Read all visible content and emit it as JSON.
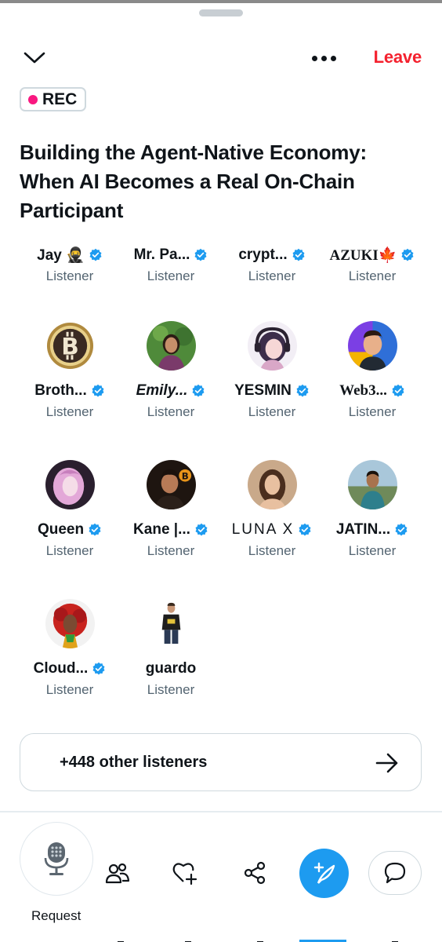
{
  "header": {
    "leave_label": "Leave",
    "collapse_icon": "chevron-down-icon",
    "more_icon": "more-dots-icon"
  },
  "rec_badge": {
    "label": "REC",
    "dot_color": "#f91880"
  },
  "space_title": "Building the Agent-Native Economy: When AI Becomes a Real On-Chain Participant",
  "participants": [
    {
      "name": "Jay 🥷",
      "role": "Listener",
      "verified": true
    },
    {
      "name": "Mr. Pa...",
      "role": "Listener",
      "verified": true
    },
    {
      "name": "crypt...",
      "role": "Listener",
      "verified": true
    },
    {
      "name": "AZUKI🍁",
      "role": "Listener",
      "verified": true
    },
    {
      "name": "Broth...",
      "role": "Listener",
      "verified": true,
      "avatar": "bitcoin-coin"
    },
    {
      "name": "Emily...",
      "role": "Listener",
      "verified": true,
      "avatar": "woman-photo"
    },
    {
      "name": "YESMIN",
      "role": "Listener",
      "verified": true,
      "avatar": "anime-headphones"
    },
    {
      "name": "Web3...",
      "role": "Listener",
      "verified": true,
      "avatar": "cartoon-man"
    },
    {
      "name": "Queen",
      "role": "Listener",
      "verified": true,
      "avatar": "anime-pink-hair"
    },
    {
      "name": "Kane |...",
      "role": "Listener",
      "verified": true,
      "avatar": "man-bitcoin"
    },
    {
      "name": "LUNA X",
      "role": "Listener",
      "verified": true,
      "avatar": "woman-portrait"
    },
    {
      "name": "JATIN...",
      "role": "Listener",
      "verified": true,
      "avatar": "man-outdoor"
    },
    {
      "name": "Cloud...",
      "role": "Listener",
      "verified": true,
      "avatar": "red-hair-woman"
    },
    {
      "name": "guardo",
      "role": "Listener",
      "verified": false,
      "avatar": "man-tshirt"
    }
  ],
  "other_listeners": {
    "label": "+448 other listeners"
  },
  "bottom_bar": {
    "request_label": "Request",
    "icons": [
      "microphone-icon",
      "people-icon",
      "heart-plus-icon",
      "share-icon",
      "compose-icon",
      "chat-bubble-icon"
    ]
  },
  "colors": {
    "accent": "#1d9bf0",
    "leave": "#f4212e",
    "verified": "#1d9bf0",
    "secondary_text": "#536471"
  }
}
